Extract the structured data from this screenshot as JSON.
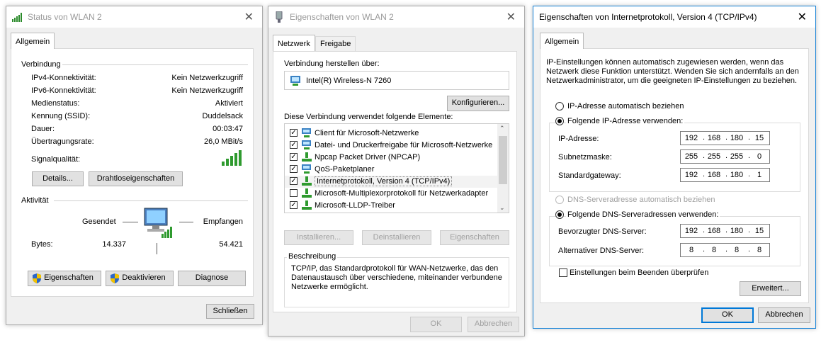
{
  "status_window": {
    "title": "Status von WLAN 2",
    "tab": "Allgemein",
    "connection": {
      "heading": "Verbindung",
      "rows": [
        {
          "label": "IPv4-Konnektivität:",
          "value": "Kein Netzwerkzugriff"
        },
        {
          "label": "IPv6-Konnektivität:",
          "value": "Kein Netzwerkzugriff"
        },
        {
          "label": "Medienstatus:",
          "value": "Aktiviert"
        },
        {
          "label": "Kennung (SSID):",
          "value": "Duddelsack"
        },
        {
          "label": "Dauer:",
          "value": "00:03:47"
        },
        {
          "label": "Übertragungsrate:",
          "value": "26,0 MBit/s"
        }
      ],
      "signal_label": "Signalqualität:",
      "signal_bars": 5,
      "details_button": "Details...",
      "wireless_button": "Drahtloseigenschaften"
    },
    "activity": {
      "heading": "Aktivität",
      "sent_label": "Gesendet",
      "received_label": "Empfangen",
      "bytes_label": "Bytes:",
      "bytes_sent": "14.337",
      "bytes_received": "54.421"
    },
    "properties_button": "Eigenschaften",
    "disable_button": "Deaktivieren",
    "diagnose_button": "Diagnose",
    "close_button": "Schließen"
  },
  "props_window": {
    "title": "Eigenschaften von WLAN 2",
    "tabs": [
      "Netzwerk",
      "Freigabe"
    ],
    "connect_using_label": "Verbindung herstellen über:",
    "adapter_name": "Intel(R) Wireless-N 7260",
    "configure_button": "Konfigurieren...",
    "items_label": "Diese Verbindung verwendet folgende Elemente:",
    "items": [
      {
        "label": "Client für Microsoft-Netzwerke",
        "checked": true,
        "icon": "network-client-icon"
      },
      {
        "label": "Datei- und Druckerfreigabe für Microsoft-Netzwerke",
        "checked": true,
        "icon": "network-service-icon"
      },
      {
        "label": "Npcap Packet Driver (NPCAP)",
        "checked": true,
        "icon": "network-protocol-icon"
      },
      {
        "label": "QoS-Paketplaner",
        "checked": true,
        "icon": "network-service-icon"
      },
      {
        "label": "Internetprotokoll, Version 4 (TCP/IPv4)",
        "checked": true,
        "icon": "network-protocol-icon"
      },
      {
        "label": "Microsoft-Multiplexorprotokoll für Netzwerkadapter",
        "checked": false,
        "icon": "network-protocol-icon"
      },
      {
        "label": "Microsoft-LLDP-Treiber",
        "checked": true,
        "icon": "network-protocol-icon"
      }
    ],
    "install_button": "Installieren...",
    "uninstall_button": "Deinstallieren",
    "properties_button": "Eigenschaften",
    "description_heading": "Beschreibung",
    "description_text": "TCP/IP, das Standardprotokoll für WAN-Netzwerke, das den Datenaustausch über verschiedene, miteinander verbundene Netzwerke ermöglicht.",
    "ok_button": "OK",
    "cancel_button": "Abbrechen"
  },
  "ipv4_window": {
    "title": "Eigenschaften von Internetprotokoll, Version 4 (TCP/IPv4)",
    "tab": "Allgemein",
    "intro_text": "IP-Einstellungen können automatisch zugewiesen werden, wenn das Netzwerk diese Funktion unterstützt. Wenden Sie sich andernfalls an den Netzwerkadministrator, um die geeigneten IP-Einstellungen zu beziehen.",
    "ip_auto_label": "IP-Adresse automatisch beziehen",
    "ip_manual_label": "Folgende IP-Adresse verwenden:",
    "ip_mode": "manual",
    "ip_address_label": "IP-Adresse:",
    "ip_address": [
      "192",
      "168",
      "180",
      "15"
    ],
    "subnet_label": "Subnetzmaske:",
    "subnet": [
      "255",
      "255",
      "255",
      "0"
    ],
    "gateway_label": "Standardgateway:",
    "gateway": [
      "192",
      "168",
      "180",
      "1"
    ],
    "dns_auto_label": "DNS-Serveradresse automatisch beziehen",
    "dns_manual_label": "Folgende DNS-Serveradressen verwenden:",
    "dns_mode": "manual",
    "preferred_dns_label": "Bevorzugter DNS-Server:",
    "preferred_dns": [
      "192",
      "168",
      "180",
      "15"
    ],
    "alternate_dns_label": "Alternativer DNS-Server:",
    "alternate_dns": [
      "8",
      "8",
      "8",
      "8"
    ],
    "validate_label": "Einstellungen beim Beenden überprüfen",
    "validate_checked": false,
    "advanced_button": "Erweitert...",
    "ok_button": "OK",
    "cancel_button": "Abbrechen"
  }
}
